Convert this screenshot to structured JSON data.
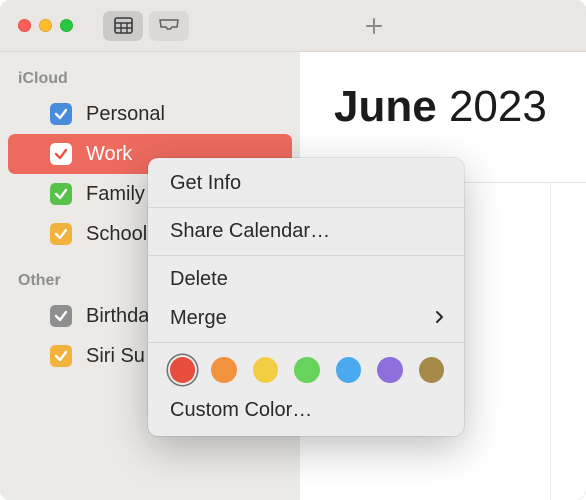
{
  "header": {
    "month": "June",
    "year": "2023"
  },
  "sidebar": {
    "sections": [
      {
        "title": "iCloud",
        "items": [
          {
            "label": "Personal",
            "color": "#4a8cdc",
            "selected": false
          },
          {
            "label": "Work",
            "color": "#e85143",
            "selected": true
          },
          {
            "label": "Family",
            "color": "#57c24a",
            "selected": false
          },
          {
            "label": "School",
            "color": "#f2b23e",
            "selected": false
          }
        ]
      },
      {
        "title": "Other",
        "items": [
          {
            "label": "Birthdays",
            "color": "#8f8f8f",
            "selected": false
          },
          {
            "label": "Siri Su",
            "color": "#f2b23e",
            "selected": false
          }
        ]
      }
    ]
  },
  "context_menu": {
    "get_info": "Get Info",
    "share": "Share Calendar…",
    "delete": "Delete",
    "merge": "Merge",
    "custom_color": "Custom Color…",
    "colors": [
      {
        "hex": "#e74c3c",
        "selected": true
      },
      {
        "hex": "#f2923e"
      },
      {
        "hex": "#f3ce45"
      },
      {
        "hex": "#67d35d"
      },
      {
        "hex": "#4aa9ef"
      },
      {
        "hex": "#8e6fdc"
      },
      {
        "hex": "#a58a4a"
      }
    ]
  }
}
